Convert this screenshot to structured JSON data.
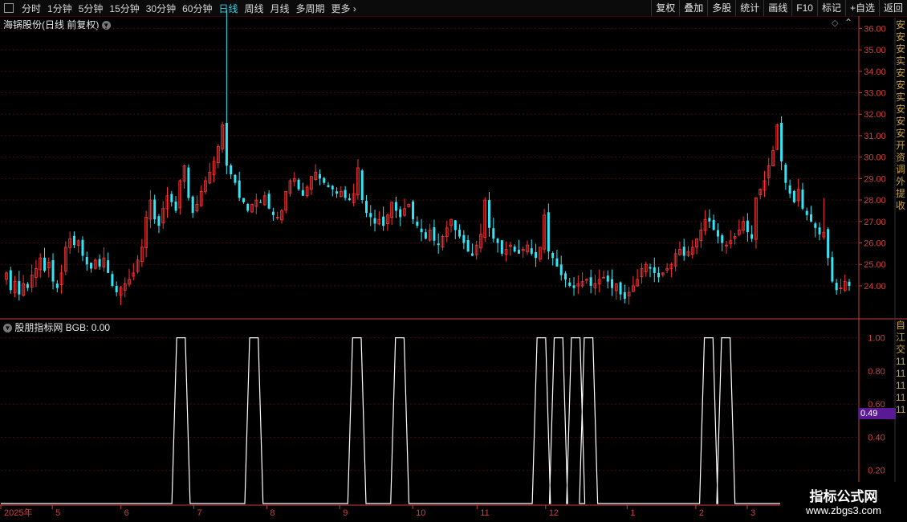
{
  "toolbar": {
    "periods": [
      "分时",
      "1分钟",
      "5分钟",
      "15分钟",
      "30分钟",
      "60分钟",
      "日线",
      "周线",
      "月线",
      "多周期",
      "更多"
    ],
    "active_period": "日线",
    "actions": [
      "复权",
      "叠加",
      "多股",
      "统计",
      "画线",
      "F10",
      "标记",
      "+自选",
      "返回"
    ]
  },
  "main_title": "海锅股份(日线 前复权)",
  "indicator_title": "股朋指标网 BGB: 0.00",
  "price_axis_labels": [
    "36.00",
    "35.00",
    "34.00",
    "33.00",
    "32.00",
    "31.00",
    "30.00",
    "29.00",
    "28.00",
    "27.00",
    "26.00",
    "25.00",
    "24.00"
  ],
  "indicator_axis_labels": [
    "1.00",
    "0.80",
    "0.60",
    "0.40",
    "0.20"
  ],
  "indicator_marker": "0.49",
  "x_axis_labels": [
    "2025年",
    "5",
    "6",
    "7",
    "8",
    "9",
    "10",
    "11",
    "12",
    "1",
    "2",
    "3"
  ],
  "right_strip_top": "安安安实安安实安安安开资调外提收",
  "right_strip_bottom": "自江交1111111111",
  "watermark": {
    "title": "指标公式网",
    "url": "www.zbgs3.com"
  },
  "colors": {
    "up": "#ff3333",
    "down": "#33e5f5",
    "grid": "#4a0a0a",
    "axis": "#c83c3c",
    "line": "#ffffff"
  },
  "chart_data": {
    "type": "candlestick",
    "price_range": [
      22.5,
      36.5
    ],
    "indicator_range": [
      0,
      1.1
    ],
    "indicator_series": {
      "name": "BGB",
      "pulses": [
        {
          "from": 0.205,
          "to": 0.215
        },
        {
          "from": 0.29,
          "to": 0.3
        },
        {
          "from": 0.41,
          "to": 0.42
        },
        {
          "from": 0.46,
          "to": 0.47
        },
        {
          "from": 0.625,
          "to": 0.635
        },
        {
          "from": 0.645,
          "to": 0.655
        },
        {
          "from": 0.665,
          "to": 0.675
        },
        {
          "from": 0.68,
          "to": 0.69
        },
        {
          "from": 0.82,
          "to": 0.83
        },
        {
          "from": 0.84,
          "to": 0.85
        }
      ],
      "last_value": 0.0
    },
    "closes": [
      24.6,
      23.8,
      24.2,
      23.6,
      24.1,
      23.9,
      24.5,
      24.8,
      25.3,
      24.7,
      25.1,
      24.2,
      23.9,
      24.6,
      25.8,
      26.2,
      25.9,
      26.1,
      25.4,
      25.0,
      24.8,
      25.2,
      24.9,
      25.3,
      24.6,
      24.0,
      23.7,
      23.9,
      24.1,
      24.3,
      24.6,
      25.2,
      25.8,
      27.2,
      28.0,
      27.1,
      26.8,
      27.6,
      28.2,
      27.9,
      27.5,
      28.9,
      29.6,
      28.1,
      27.4,
      27.8,
      28.4,
      28.9,
      29.3,
      29.8,
      30.5,
      31.5,
      29.6,
      29.2,
      28.8,
      28.1,
      27.9,
      27.5,
      27.8,
      28.0,
      27.9,
      28.2,
      27.6,
      27.3,
      27.2,
      27.5,
      28.4,
      28.9,
      29.0,
      28.5,
      28.2,
      28.6,
      29.1,
      29.3,
      29.0,
      28.8,
      28.6,
      28.5,
      28.3,
      28.4,
      28.1,
      28.0,
      28.3,
      29.5,
      28.0,
      27.4,
      27.2,
      26.9,
      27.1,
      26.8,
      27.3,
      27.9,
      27.5,
      27.2,
      27.6,
      27.8,
      27.1,
      26.8,
      26.5,
      26.2,
      26.6,
      26.1,
      25.9,
      26.3,
      26.7,
      27.1,
      26.6,
      26.3,
      26.0,
      25.6,
      25.4,
      25.9,
      26.4,
      28.0,
      26.7,
      26.2,
      26.0,
      25.5,
      25.7,
      25.9,
      25.6,
      25.5,
      25.7,
      25.9,
      25.5,
      25.3,
      25.8,
      27.3,
      25.6,
      25.3,
      24.9,
      24.5,
      24.3,
      24.0,
      23.9,
      24.1,
      24.2,
      24.3,
      24.0,
      24.1,
      24.3,
      24.4,
      24.2,
      23.9,
      24.1,
      23.6,
      23.4,
      23.7,
      24.0,
      24.3,
      24.8,
      25.0,
      24.8,
      24.6,
      24.4,
      24.6,
      24.8,
      25.0,
      25.5,
      25.7,
      25.4,
      25.6,
      25.8,
      26.2,
      26.6,
      27.1,
      27.0,
      26.6,
      26.3,
      26.0,
      25.9,
      26.1,
      26.3,
      26.6,
      27.0,
      26.5,
      26.2,
      28.1,
      28.5,
      28.9,
      29.6,
      30.3,
      31.5,
      29.8,
      28.8,
      28.3,
      27.9,
      28.5,
      27.6,
      27.3,
      27.0,
      26.7,
      26.4,
      26.5,
      25.3,
      24.2,
      23.8,
      23.9,
      24.2,
      24.0
    ]
  }
}
